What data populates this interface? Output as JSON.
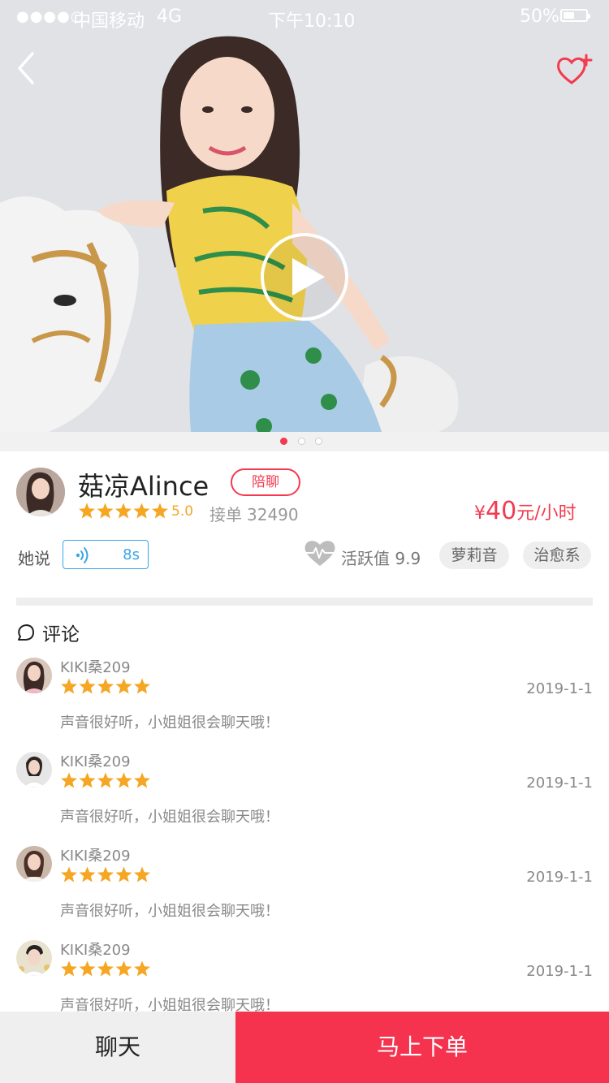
{
  "status_bar": {
    "carrier": "中国移动",
    "network": "4G",
    "time": "下午10:10",
    "battery": "50%",
    "battery_level": 0.5
  },
  "hero": {
    "slide_count": 3,
    "active_slide": 1
  },
  "profile": {
    "name": "菇凉Alince",
    "tag": "陪聊",
    "rating": "5.0",
    "rating_stars": 5,
    "orders_label": "接单",
    "orders_count": "32490",
    "price_symbol": "¥",
    "price_value": "40",
    "price_unit": "元/小时",
    "says_label": "她说",
    "voice_duration": "8s",
    "activity_label": "活跃值",
    "activity_value": "9.9",
    "tags": [
      "萝莉音",
      "治愈系"
    ]
  },
  "comments": {
    "title": "评论",
    "items": [
      {
        "name": "KIKI桑209",
        "stars": 5,
        "date": "2019-1-1",
        "text": "声音很好听，小姐姐很会聊天哦！"
      },
      {
        "name": "KIKI桑209",
        "stars": 5,
        "date": "2019-1-1",
        "text": "声音很好听，小姐姐很会聊天哦！"
      },
      {
        "name": "KIKI桑209",
        "stars": 5,
        "date": "2019-1-1",
        "text": "声音很好听，小姐姐很会聊天哦！"
      },
      {
        "name": "KIKI桑209",
        "stars": 5,
        "date": "2019-1-1",
        "text": "声音很好听，小姐姐很会聊天哦！"
      }
    ]
  },
  "bottom": {
    "chat_label": "聊天",
    "order_label": "马上下单"
  },
  "colors": {
    "accent": "#f33a4f",
    "star": "#f5a623",
    "voice": "#3aa5e7"
  }
}
